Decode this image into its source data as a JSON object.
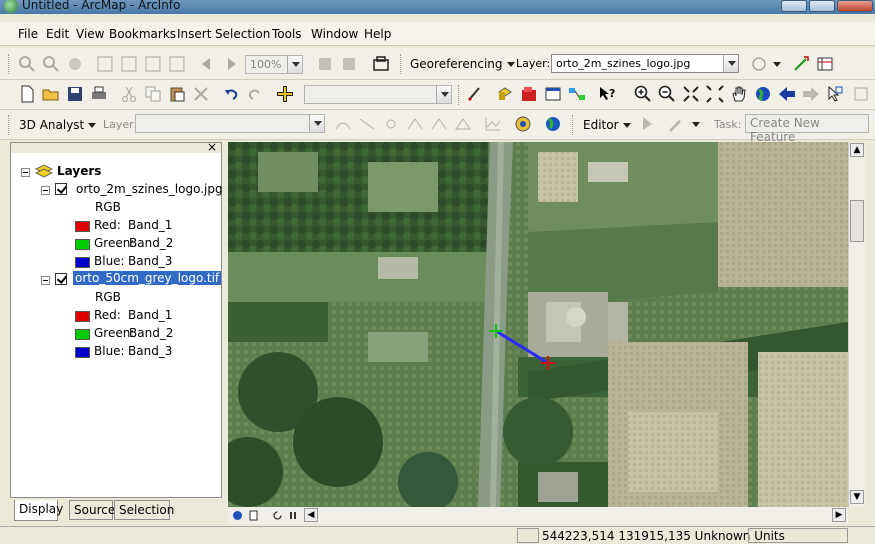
{
  "window": {
    "title": "Untitled - ArcMap - ArcInfo"
  },
  "menu": [
    "File",
    "Edit",
    "View",
    "Bookmarks",
    "Insert",
    "Selection",
    "Tools",
    "Window",
    "Help"
  ],
  "georef_toolbar": {
    "zoom": "100%",
    "georeferencing_label": "Georeferencing",
    "layer_label": "Layer:",
    "layer_value": "orto_2m_szines_logo.jpg"
  },
  "analyst_toolbar": {
    "analyst_label": "3D Analyst",
    "layer_label": "Layer:",
    "editor_label": "Editor",
    "task_label": "Task:",
    "task_value": "Create New Feature"
  },
  "toc": {
    "root": "Layers",
    "layers": [
      {
        "name": "orto_2m_szines_logo.jpg",
        "rgb": "RGB",
        "bands": [
          {
            "channel": "Red:",
            "band": "Band_1",
            "color": "#e00000"
          },
          {
            "channel": "Green:",
            "band": "Band_2",
            "color": "#00cc00"
          },
          {
            "channel": "Blue:",
            "band": "Band_3",
            "color": "#0000cc"
          }
        ]
      },
      {
        "name": "orto_50cm_grey_logo.tif",
        "rgb": "RGB",
        "bands": [
          {
            "channel": "Red:",
            "band": "Band_1",
            "color": "#e00000"
          },
          {
            "channel": "Green:",
            "band": "Band_2",
            "color": "#00cc00"
          },
          {
            "channel": "Blue:",
            "band": "Band_3",
            "color": "#0000cc"
          }
        ]
      }
    ],
    "tabs": [
      "Display",
      "Source",
      "Selection"
    ]
  },
  "status": {
    "coords": "544223,514  131915,135 Unknown Units"
  }
}
